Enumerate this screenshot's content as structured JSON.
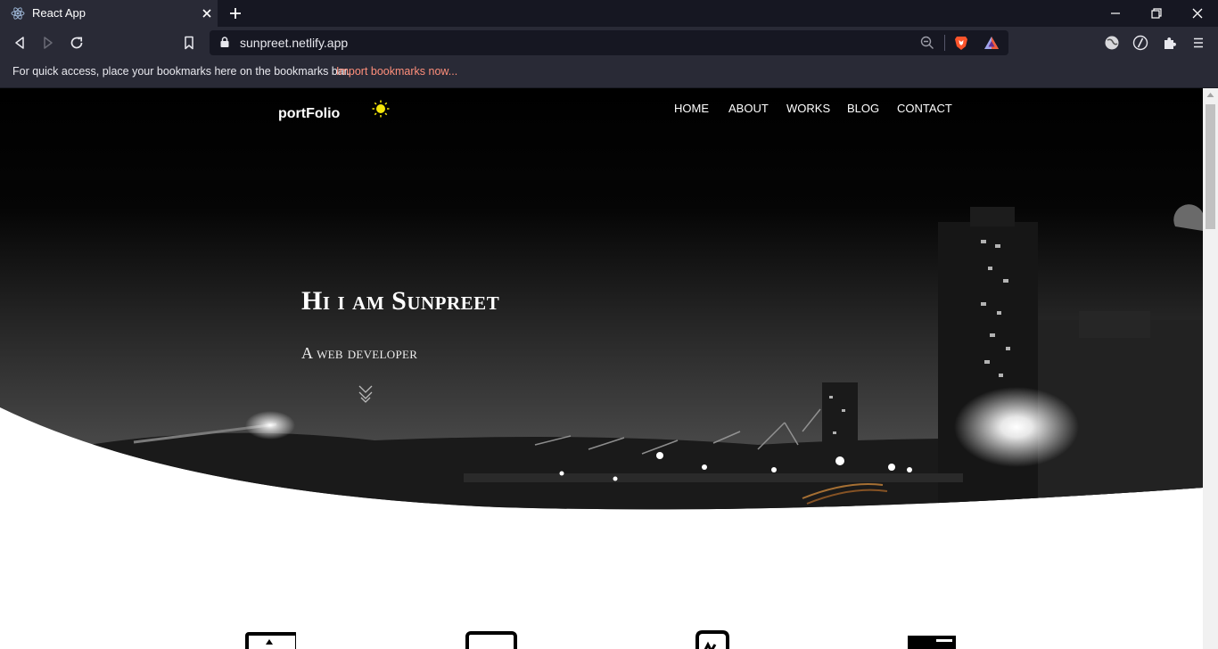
{
  "browser": {
    "tab": {
      "title": "React App"
    },
    "url": "sunpreet.netlify.app",
    "bookmarks_bar": {
      "message": "For quick access, place your bookmarks here on the bookmarks bar.",
      "link": "Import bookmarks now..."
    }
  },
  "site": {
    "brand": "portFolio",
    "nav": [
      "HOME",
      "ABOUT",
      "WORKS",
      "BLOG",
      "CONTACT"
    ],
    "hero": {
      "title": "Hi i am Sunpreet",
      "subtitle": "A web developer"
    }
  },
  "icons": {
    "theme_toggle": "sun-icon",
    "scroll_hint": "double-chevron-down-icon",
    "services": [
      "profile-card-icon",
      "monitor-icon",
      "code-icon",
      "server-icon"
    ]
  },
  "colors": {
    "chrome_dark": "#161722",
    "chrome": "#292a36",
    "import_link": "#ff8f7b",
    "sun": "#f5e60a"
  }
}
